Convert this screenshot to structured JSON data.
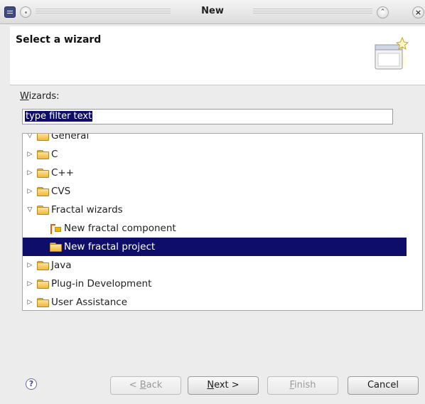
{
  "window": {
    "title": "New",
    "icons": {
      "app": "eclipse-app-icon",
      "sticky": "sticky-pin-icon",
      "shade": "shade-chevron-icon",
      "close": "close-icon"
    }
  },
  "header": {
    "title": "Select a wizard",
    "banner_icon": "new-wizard-banner-icon"
  },
  "wizards": {
    "label_mnemonic": "W",
    "label_rest": "izards:",
    "filter_value": "type filter text"
  },
  "tree": {
    "rows": [
      {
        "label": "General",
        "twisty": "expanded",
        "icon": "folder-icon",
        "indent": 0,
        "selected": false
      },
      {
        "label": "C",
        "twisty": "collapsed",
        "icon": "folder-icon",
        "indent": 0,
        "selected": false
      },
      {
        "label": "C++",
        "twisty": "collapsed",
        "icon": "folder-icon",
        "indent": 0,
        "selected": false
      },
      {
        "label": "CVS",
        "twisty": "collapsed",
        "icon": "folder-icon",
        "indent": 0,
        "selected": false
      },
      {
        "label": "Fractal wizards",
        "twisty": "expanded",
        "icon": "folder-icon",
        "indent": 0,
        "selected": false
      },
      {
        "label": "New fractal component",
        "twisty": "none",
        "icon": "fractal-component-icon",
        "indent": 1,
        "selected": false
      },
      {
        "label": "New fractal project",
        "twisty": "none",
        "icon": "folder-icon",
        "indent": 1,
        "selected": true
      },
      {
        "label": "Java",
        "twisty": "collapsed",
        "icon": "folder-icon",
        "indent": 0,
        "selected": false
      },
      {
        "label": "Plug-in Development",
        "twisty": "collapsed",
        "icon": "folder-icon",
        "indent": 0,
        "selected": false
      },
      {
        "label": "User Assistance",
        "twisty": "collapsed",
        "icon": "folder-icon",
        "indent": 0,
        "selected": false
      }
    ]
  },
  "footer": {
    "help_icon": "help-icon",
    "back": {
      "mnemonic": "B",
      "before": "< ",
      "after": "ack",
      "enabled": false
    },
    "next": {
      "mnemonic": "N",
      "before": "",
      "after": "ext >",
      "enabled": true
    },
    "finish": {
      "mnemonic": "F",
      "before": "",
      "after": "inish",
      "enabled": false
    },
    "cancel": {
      "label": "Cancel",
      "enabled": true
    }
  },
  "colors": {
    "selection": "#0e0e6a",
    "folder": "#efb93b",
    "window_bg": "#ececec"
  }
}
